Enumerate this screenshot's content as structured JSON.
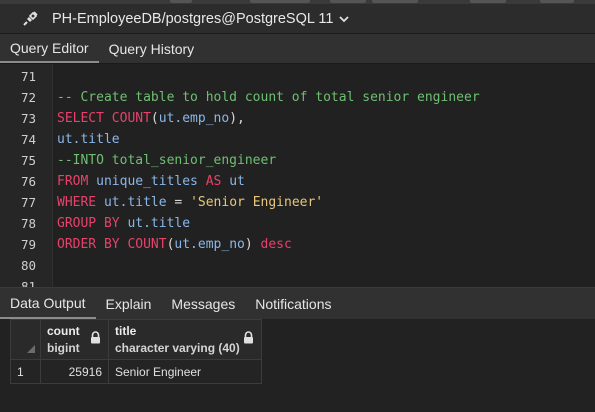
{
  "connection": {
    "label": "PH-EmployeeDB/postgres@PostgreSQL 11"
  },
  "query_tabs": [
    "Query Editor",
    "Query History"
  ],
  "editor": {
    "lines": [
      {
        "num": "71",
        "tokens": []
      },
      {
        "num": "72",
        "tokens": [
          {
            "t": "cm",
            "v": "-- Create table to hold count of total senior engineer"
          }
        ]
      },
      {
        "num": "73",
        "tokens": [
          {
            "t": "kw",
            "v": "SELECT COUNT"
          },
          {
            "t": "pl",
            "v": "("
          },
          {
            "t": "id",
            "v": "ut.emp_no"
          },
          {
            "t": "pl",
            "v": "),"
          }
        ]
      },
      {
        "num": "74",
        "tokens": [
          {
            "t": "id",
            "v": "ut.title"
          }
        ]
      },
      {
        "num": "75",
        "tokens": [
          {
            "t": "cm",
            "v": "--INTO total_senior_engineer"
          }
        ]
      },
      {
        "num": "76",
        "tokens": [
          {
            "t": "kw",
            "v": "FROM"
          },
          {
            "t": "pl",
            "v": " "
          },
          {
            "t": "id",
            "v": "unique_titles"
          },
          {
            "t": "pl",
            "v": " "
          },
          {
            "t": "kw",
            "v": "AS"
          },
          {
            "t": "pl",
            "v": " "
          },
          {
            "t": "id",
            "v": "ut"
          }
        ]
      },
      {
        "num": "77",
        "tokens": [
          {
            "t": "kw",
            "v": "WHERE"
          },
          {
            "t": "pl",
            "v": " "
          },
          {
            "t": "id",
            "v": "ut.title"
          },
          {
            "t": "pl",
            "v": " = "
          },
          {
            "t": "st",
            "v": "'Senior Engineer'"
          }
        ]
      },
      {
        "num": "78",
        "tokens": [
          {
            "t": "kw",
            "v": "GROUP BY"
          },
          {
            "t": "pl",
            "v": " "
          },
          {
            "t": "id",
            "v": "ut.title"
          }
        ]
      },
      {
        "num": "79",
        "tokens": [
          {
            "t": "kw",
            "v": "ORDER BY COUNT"
          },
          {
            "t": "pl",
            "v": "("
          },
          {
            "t": "id",
            "v": "ut.emp_no"
          },
          {
            "t": "pl",
            "v": ") "
          },
          {
            "t": "kw",
            "v": "desc"
          }
        ]
      },
      {
        "num": "80",
        "tokens": []
      },
      {
        "num": "81",
        "tokens": []
      }
    ]
  },
  "output_tabs": [
    "Data Output",
    "Explain",
    "Messages",
    "Notifications"
  ],
  "grid": {
    "columns": [
      {
        "name": "count",
        "type": "bigint"
      },
      {
        "name": "title",
        "type": "character varying (40)"
      }
    ],
    "rows": [
      {
        "row": "1",
        "count": "25916",
        "title": "Senior Engineer"
      }
    ]
  },
  "colors": {
    "keyword": "#e8416b",
    "identifier": "#8ab7e8",
    "comment": "#6fbf73",
    "string": "#e7c77a"
  }
}
